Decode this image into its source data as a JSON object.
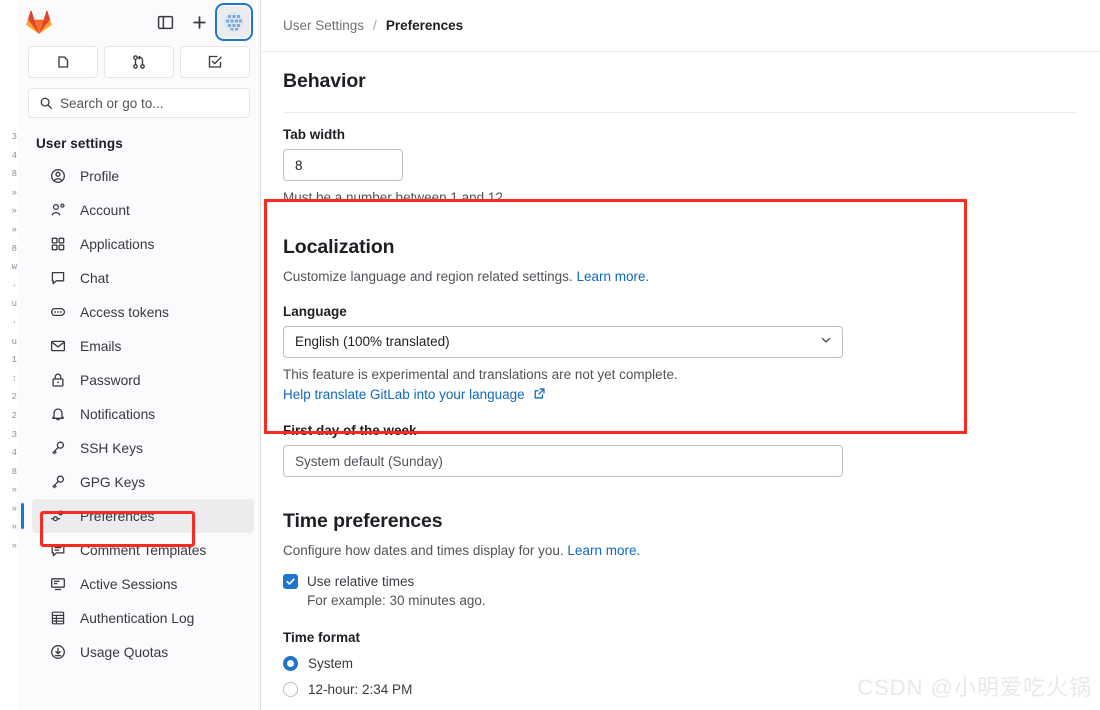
{
  "window": {
    "logo": "gitlab-logo",
    "toolbar": {
      "sidebar_toggle_icon": "panel-toggle-icon",
      "create_new_icon": "plus-icon",
      "avatar_icon": "user-avatar-icon"
    },
    "quick_actions": [
      {
        "name": "issues",
        "icon": "issues-icon"
      },
      {
        "name": "merge-requests",
        "icon": "merge-request-icon"
      },
      {
        "name": "todos",
        "icon": "todo-checkbox-icon"
      }
    ],
    "search": {
      "placeholder": "Search or go to...",
      "icon": "search-icon"
    }
  },
  "sidebar": {
    "title": "User settings",
    "items": [
      {
        "label": "Profile",
        "icon": "user-circle-icon",
        "active": false
      },
      {
        "label": "Account",
        "icon": "account-gear-icon",
        "active": false
      },
      {
        "label": "Applications",
        "icon": "applications-grid-icon",
        "active": false
      },
      {
        "label": "Chat",
        "icon": "chat-bubble-icon",
        "active": false
      },
      {
        "label": "Access tokens",
        "icon": "token-icon",
        "active": false
      },
      {
        "label": "Emails",
        "icon": "envelope-icon",
        "active": false
      },
      {
        "label": "Password",
        "icon": "lock-icon",
        "active": false
      },
      {
        "label": "Notifications",
        "icon": "bell-icon",
        "active": false
      },
      {
        "label": "SSH Keys",
        "icon": "key-icon",
        "active": false
      },
      {
        "label": "GPG Keys",
        "icon": "key-icon",
        "active": false
      },
      {
        "label": "Preferences",
        "icon": "preferences-sliders-icon",
        "active": true
      },
      {
        "label": "Comment Templates",
        "icon": "comment-lines-icon",
        "active": false
      },
      {
        "label": "Active Sessions",
        "icon": "monitor-icon",
        "active": false
      },
      {
        "label": "Authentication Log",
        "icon": "log-grid-icon",
        "active": false
      },
      {
        "label": "Usage Quotas",
        "icon": "download-circle-icon",
        "active": false
      }
    ]
  },
  "breadcrumb": {
    "parent": "User Settings",
    "separator": "/",
    "current": "Preferences"
  },
  "behavior": {
    "heading": "Behavior",
    "tab_width_label": "Tab width",
    "tab_width_value": "8",
    "tab_width_help": "Must be a number between 1 and 12"
  },
  "localization": {
    "heading": "Localization",
    "description": "Customize language and region related settings.",
    "learn_more": "Learn more.",
    "language_label": "Language",
    "language_value": "English (100% translated)",
    "language_options": [
      "English (100% translated)"
    ],
    "language_help": "This feature is experimental and translations are not yet complete.",
    "translate_link": "Help translate GitLab into your language",
    "external_link_icon": "external-link-icon",
    "first_day_label": "First day of the week",
    "first_day_value": "System default (Sunday)",
    "first_day_options": [
      "System default (Sunday)"
    ]
  },
  "time_preferences": {
    "heading": "Time preferences",
    "description": "Configure how dates and times display for you.",
    "learn_more": "Learn more.",
    "relative_times_label": "Use relative times",
    "relative_times_checked": true,
    "relative_times_example": "For example: 30 minutes ago.",
    "time_format_label": "Time format",
    "time_format_options": [
      {
        "label": "System",
        "selected": true
      },
      {
        "label": "12-hour: 2:34 PM",
        "selected": false
      }
    ]
  },
  "annotations": {
    "highlight_color": "#fb2b20",
    "localization_box": "localization-highlight",
    "preferences_box": "preferences-highlight"
  },
  "watermark": "CSDN @小明爱吃火锅",
  "edge_artifact": "3\n4\n8\n»\n»\n»\n8\nw\n·\nu\n·\nu\n1\n:\n2\n2\n3\n4\n8\n»\n»\n»\n»"
}
